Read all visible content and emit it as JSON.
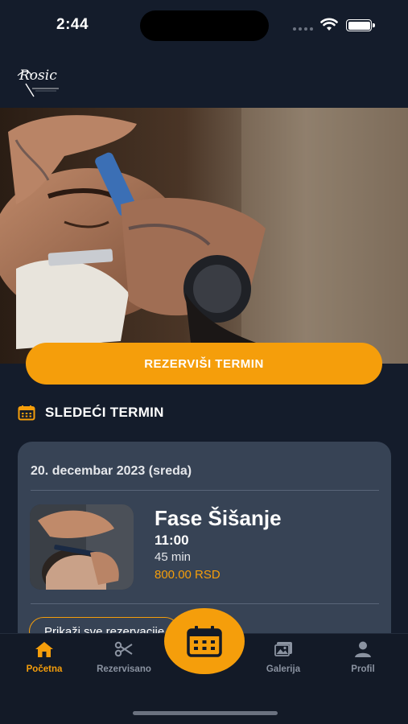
{
  "status": {
    "time": "2:44"
  },
  "brand": {
    "logo_text": "Rosic"
  },
  "hero": {
    "cta_label": "REZERVIŠI TERMIN"
  },
  "next_appointment": {
    "section_title": "SLEDEĆI TERMIN",
    "date": "20. decembar 2023 (sreda)",
    "service_name": "Fase Šišanje",
    "time": "11:00",
    "duration": "45 min",
    "price": "800.00 RSD",
    "show_all_label": "Prikaži sve rezervacije"
  },
  "tabbar": {
    "items": [
      {
        "label": "Početna",
        "icon": "home-icon",
        "active": true
      },
      {
        "label": "Rezervisano",
        "icon": "scissors-icon",
        "active": false
      },
      {
        "label": "",
        "icon": "calendar-icon",
        "active": false
      },
      {
        "label": "Galerija",
        "icon": "gallery-icon",
        "active": false
      },
      {
        "label": "Profil",
        "icon": "person-icon",
        "active": false
      }
    ]
  },
  "colors": {
    "accent": "#f59e0b",
    "background": "#141c2b",
    "card": "#374355"
  }
}
